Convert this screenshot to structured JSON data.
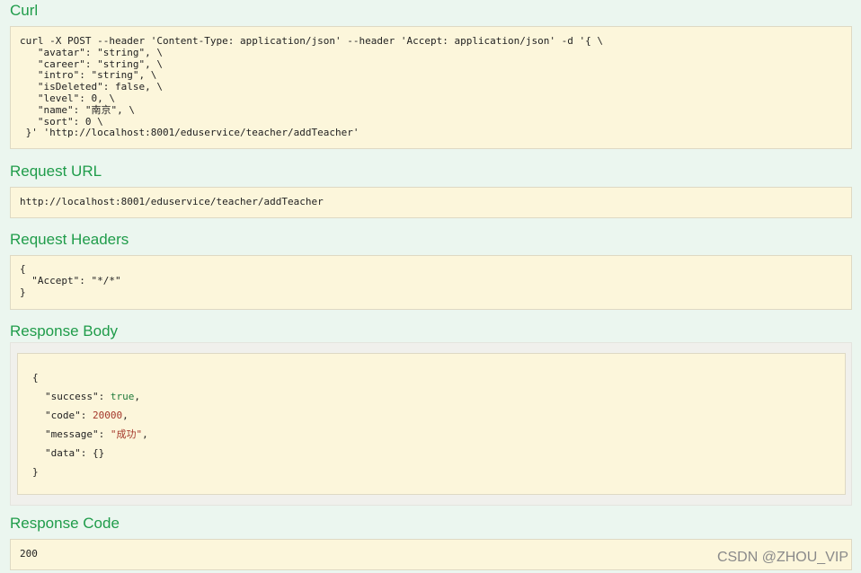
{
  "curl": {
    "heading": "Curl",
    "lines": [
      "curl -X POST --header 'Content-Type: application/json' --header 'Accept: application/json' -d '{ \\",
      "   \"avatar\": \"string\", \\",
      "   \"career\": \"string\", \\",
      "   \"intro\": \"string\", \\",
      "   \"isDeleted\": false, \\",
      "   \"level\": 0, \\",
      "   \"name\": \"南京\", \\",
      "   \"sort\": 0 \\",
      " }' 'http://localhost:8001/eduservice/teacher/addTeacher'"
    ]
  },
  "request_url": {
    "heading": "Request URL",
    "value": "http://localhost:8001/eduservice/teacher/addTeacher"
  },
  "request_headers": {
    "heading": "Request Headers",
    "lines": [
      "{",
      "  \"Accept\": \"*/*\"",
      "}"
    ]
  },
  "response_body": {
    "heading": "Response Body",
    "open": "{",
    "close": "}",
    "fields": [
      {
        "key": "\"success\"",
        "value": "true",
        "sep": ","
      },
      {
        "key": "\"code\"",
        "value": "20000",
        "sep": ","
      },
      {
        "key": "\"message\"",
        "value": "\"成功\"",
        "sep": ","
      },
      {
        "key": "\"data\"",
        "value": "{}",
        "sep": ""
      }
    ]
  },
  "response_code": {
    "heading": "Response Code",
    "value": "200"
  },
  "watermark": "CSDN @ZHOU_VIP",
  "colors": {
    "heading": "#1f9c4a",
    "panel_bg": "#fcf6db",
    "page_bg": "#ebf6ef",
    "bool": "#1f7a3a",
    "number": "#a4372a",
    "string": "#a4372a"
  }
}
